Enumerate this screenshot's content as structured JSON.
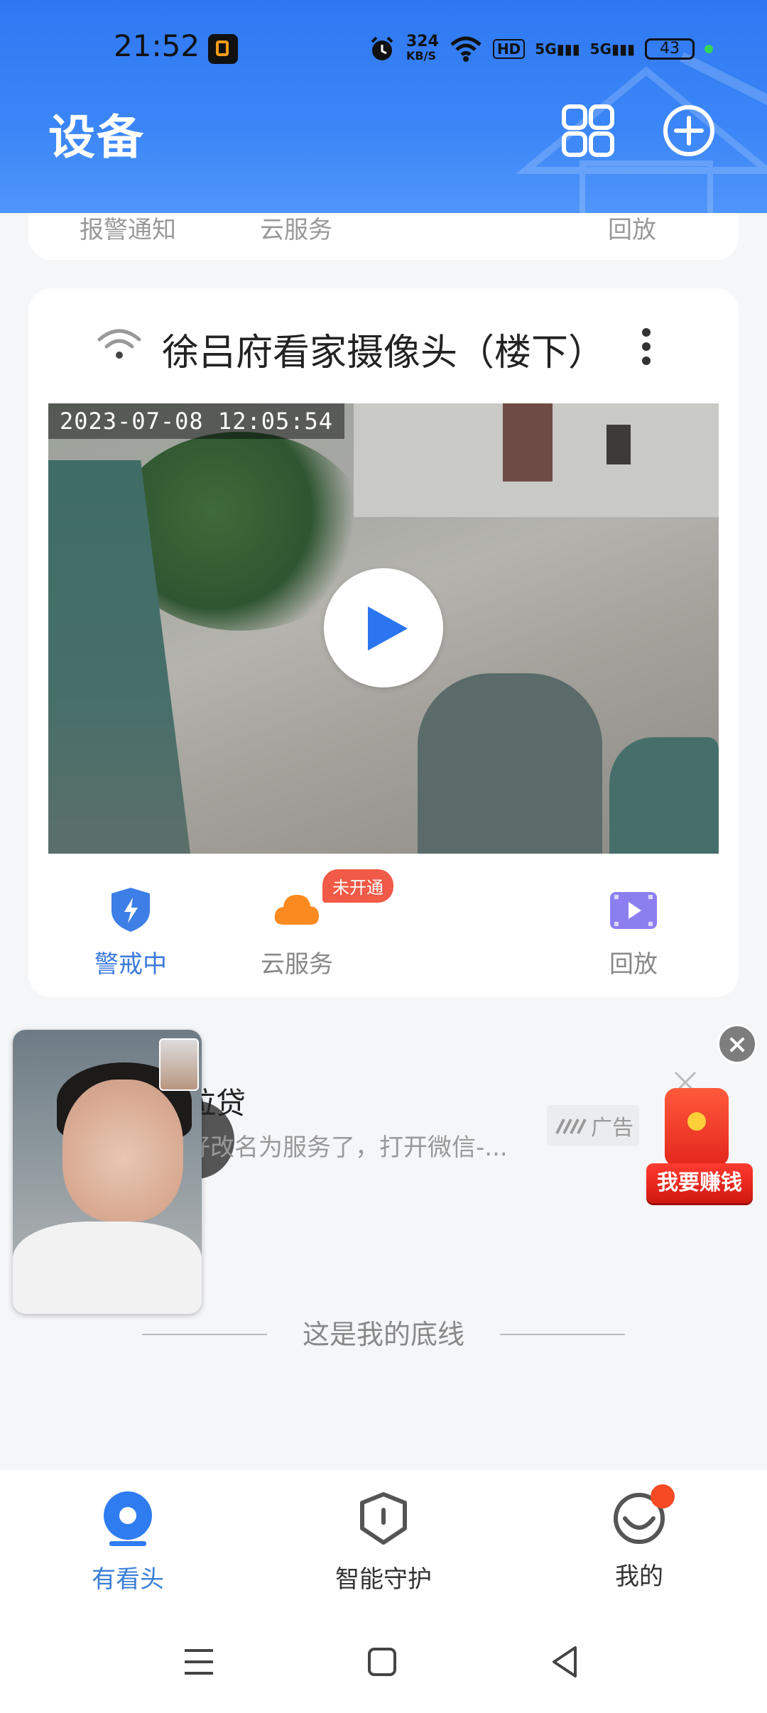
{
  "status_bar": {
    "time": "21:52",
    "net_speed_value": "324",
    "net_speed_unit": "KB/S",
    "hd_label": "HD",
    "signal1_label": "5G",
    "signal2_label": "5G",
    "battery": "43"
  },
  "header": {
    "title": "设备"
  },
  "prev_card": {
    "action1": "报警通知",
    "action2": "云服务",
    "action3": "回放"
  },
  "camera_card": {
    "name": "徐吕府看家摄像头（楼下）",
    "timestamp": "2023-07-08  12:05:54",
    "actions": [
      {
        "label": "警戒中"
      },
      {
        "label": "云服务"
      },
      {
        "label": "回放"
      }
    ],
    "cloud_badge": "未开通"
  },
  "ad": {
    "title": "拉贷",
    "description": "好改名为服务了，打开微信-...",
    "tag": "广告",
    "redpacket_label": "我要赚钱"
  },
  "footer_text": "这是我的底线",
  "tabbar": {
    "tabs": [
      {
        "label": "有看头"
      },
      {
        "label": "智能守护"
      },
      {
        "label": "我的"
      }
    ]
  },
  "colors": {
    "header_blue": "#2f78f2",
    "accent_blue": "#3a7fd8",
    "badge_red": "#f05a46"
  }
}
